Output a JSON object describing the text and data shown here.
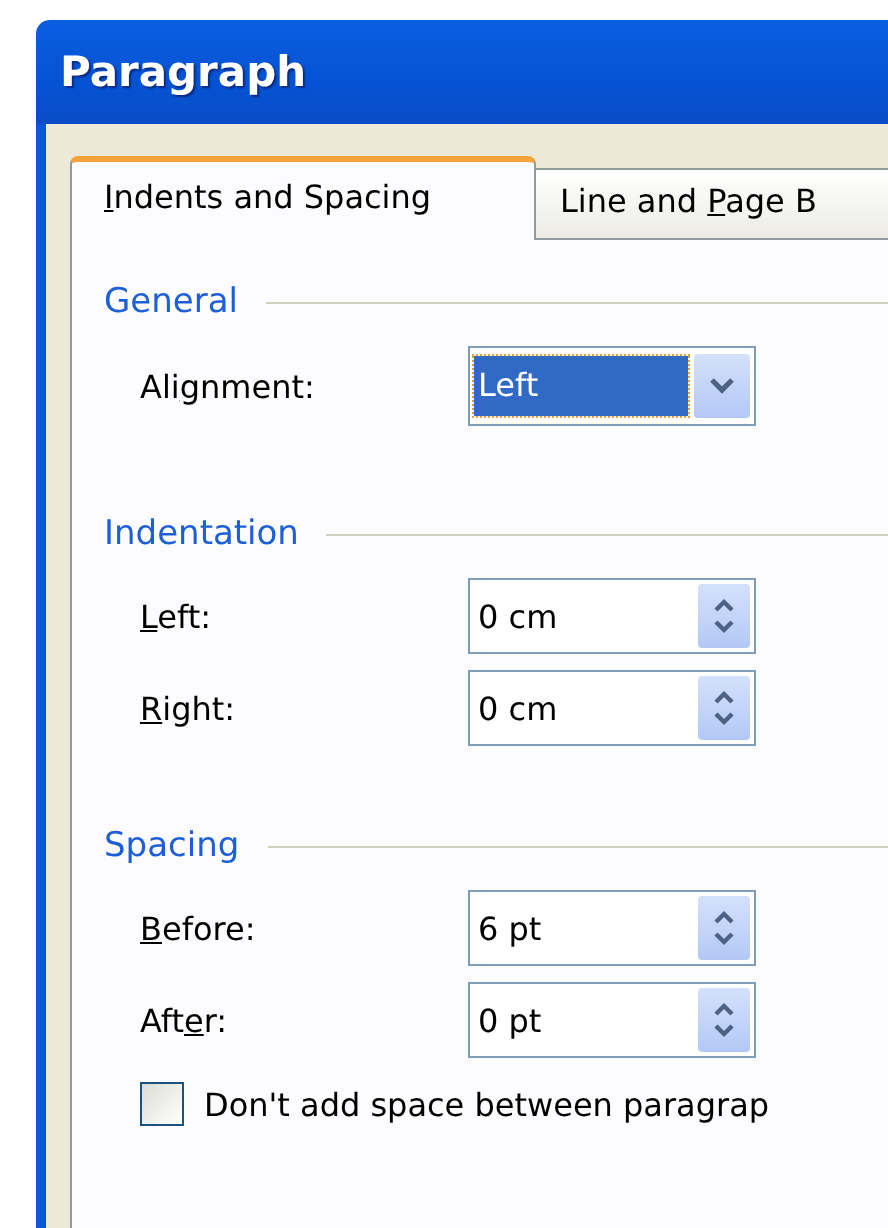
{
  "window": {
    "title": "Paragraph"
  },
  "tabs": [
    {
      "label": {
        "key": "I",
        "post": "ndents and Spacing"
      },
      "selected": true
    },
    {
      "label": {
        "pre": "Line and ",
        "key": "P",
        "post": "age B"
      },
      "selected": false
    }
  ],
  "groups": [
    {
      "title": "General",
      "rows": [
        {
          "kind": "dropdown",
          "label": {
            "pre": "Ali",
            "key": "g",
            "post": "nment:"
          },
          "value": "Left",
          "focused": true
        }
      ]
    },
    {
      "title": "Indentation",
      "rows": [
        {
          "kind": "spin",
          "label": {
            "key": "L",
            "post": "eft:"
          },
          "value": "0 cm"
        },
        {
          "kind": "spin",
          "label": {
            "key": "R",
            "post": "ight:"
          },
          "value": "0 cm"
        }
      ]
    },
    {
      "title": "Spacing",
      "rows": [
        {
          "kind": "spin",
          "label": {
            "key": "B",
            "post": "efore:"
          },
          "value": "6 pt"
        },
        {
          "kind": "spin",
          "label": {
            "pre": "Aft",
            "key": "e",
            "post": "r:"
          },
          "value": "0 pt"
        }
      ]
    }
  ],
  "checkbox": {
    "label": "Don't add space between paragrap",
    "checked": false
  }
}
